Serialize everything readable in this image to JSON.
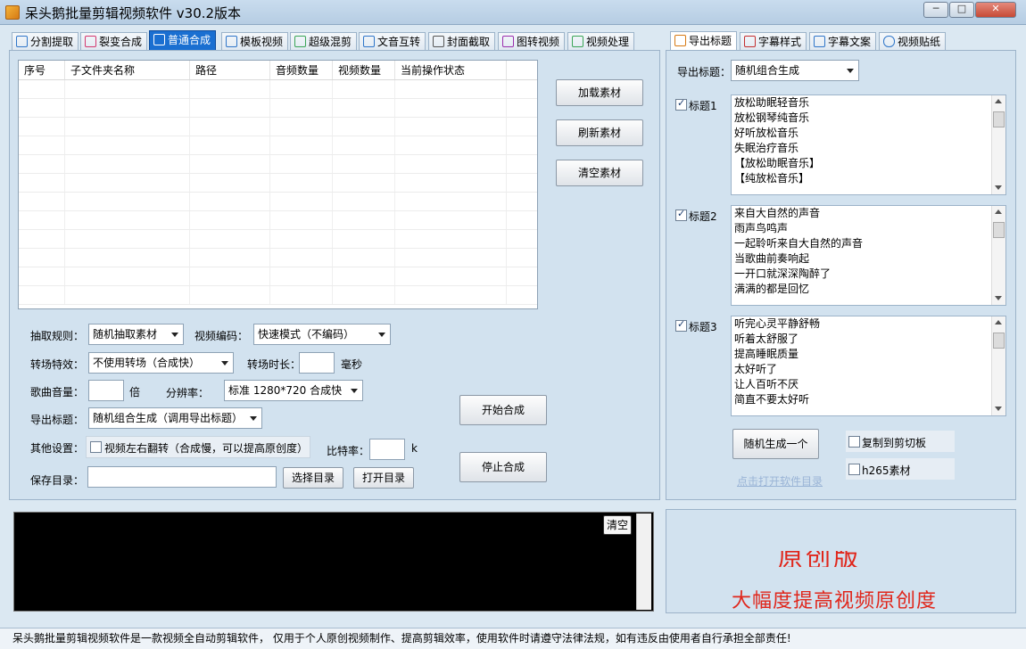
{
  "window": {
    "title": "呆头鹅批量剪辑视频软件    v30.2版本",
    "controls": {
      "minimize": "─",
      "maximize": "□",
      "close": "✕"
    }
  },
  "left_tabs": [
    {
      "label": "分割提取",
      "icon": "split-icon"
    },
    {
      "label": "裂变合成",
      "icon": "fission-icon"
    },
    {
      "label": "普通合成",
      "icon": "play-icon",
      "active": true
    },
    {
      "label": "模板视频",
      "icon": "template-icon"
    },
    {
      "label": "超级混剪",
      "icon": "waveform-icon"
    },
    {
      "label": "文音互转",
      "icon": "microphone-icon"
    },
    {
      "label": "封面截取",
      "icon": "image-icon"
    },
    {
      "label": "图转视频",
      "icon": "image-video-icon"
    },
    {
      "label": "视频处理",
      "icon": "video-process-icon"
    }
  ],
  "table": {
    "columns": [
      "序号",
      "子文件夹名称",
      "路径",
      "音频数量",
      "视频数量",
      "当前操作状态"
    ]
  },
  "material_buttons": {
    "load": "加载素材",
    "refresh": "刷新素材",
    "clear": "清空素材"
  },
  "form": {
    "extract_rule_label": "抽取规则：",
    "extract_rule_value": "随机抽取素材",
    "video_codec_label": "视频编码：",
    "video_codec_value": "快速模式（不编码）",
    "transition_label": "转场特效：",
    "transition_value": "不使用转场（合成快）",
    "transition_duration_label": "转场时长：",
    "transition_duration_value": "",
    "transition_duration_unit": "毫秒",
    "song_volume_label": "歌曲音量：",
    "song_volume_value": "",
    "song_volume_unit": "倍",
    "resolution_label": "分辨率：",
    "resolution_value": "标准 1280*720 合成快",
    "export_title_label": "导出标题：",
    "export_title_value": "随机组合生成（调用导出标题）",
    "other_settings_label": "其他设置：",
    "flip_option": "视频左右翻转（合成慢，可以提高原创度）",
    "flip_checked": false,
    "bitrate_label": "比特率：",
    "bitrate_value": "",
    "bitrate_unit": "k",
    "save_dir_label": "保存目录：",
    "save_dir_value": "",
    "choose_dir": "选择目录",
    "open_dir": "打开目录",
    "start": "开始合成",
    "stop": "停止合成"
  },
  "log": {
    "clear": "清空"
  },
  "right_tabs": [
    {
      "label": "导出标题",
      "icon": "export-title-icon",
      "active": true
    },
    {
      "label": "字幕样式",
      "icon": "subtitle-style-icon"
    },
    {
      "label": "字幕文案",
      "icon": "subtitle-text-icon"
    },
    {
      "label": "视频贴纸",
      "icon": "star-icon"
    }
  ],
  "export_title": {
    "label": "导出标题：",
    "mode": "随机组合生成",
    "groups": [
      {
        "label": "标题1",
        "checked": true,
        "lines": [
          "放松助眠轻音乐",
          "放松钢琴纯音乐",
          "好听放松音乐",
          "失眠治疗音乐",
          "【放松助眠音乐】",
          "【纯放松音乐】"
        ]
      },
      {
        "label": "标题2",
        "checked": true,
        "lines": [
          "来自大自然的声音",
          "雨声鸟鸣声",
          "一起聆听来自大自然的声音",
          "当歌曲前奏响起",
          "一开口就深深陶醉了",
          "满满的都是回忆"
        ]
      },
      {
        "label": "标题3",
        "checked": true,
        "lines": [
          "听完心灵平静舒畅",
          "听着太舒服了",
          "提高睡眠质量",
          "太好听了",
          "让人百听不厌",
          "简直不要太好听"
        ]
      }
    ],
    "random_generate": "随机生成一个",
    "copy_to_clipboard": "复制到剪切板",
    "copy_checked": false,
    "h265": "h265素材",
    "h265_checked": false,
    "open_software_dir": "点击打开软件目录"
  },
  "ad": {
    "text": "大幅度提高视频原创度",
    "partial_text": "原创版"
  },
  "status": {
    "text": "呆头鹅批量剪辑视频软件是一款视频全自动剪辑软件， 仅用于个人原创视频制作、提高剪辑效率，使用软件时请遵守法律法规，如有违反由使用者自行承担全部责任!"
  },
  "colors": {
    "active_tab": "#1a6fd1",
    "panel": "#d2e2ef",
    "ad_red": "#e0261b"
  }
}
